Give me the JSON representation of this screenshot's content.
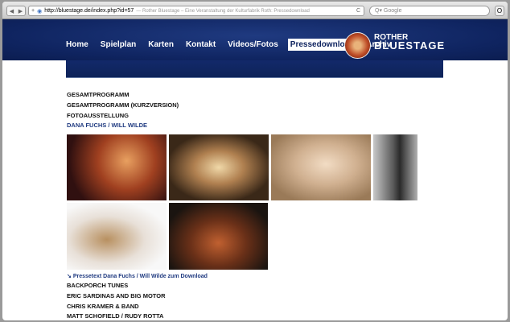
{
  "browser": {
    "url": "http://bluestage.de/index.php?id=57",
    "page_title": "— Rother Bluestage – Eine Veranstaltung der Kulturfabrik Roth: Pressedownload",
    "search_placeholder": "Google",
    "back": "◀",
    "forward": "▶",
    "plus": "+",
    "reload": "C",
    "reader": "O"
  },
  "nav": [
    "Home",
    "Spielplan",
    "Karten",
    "Kontakt",
    "Videos/Fotos",
    "Pressedownload",
    "Archiv"
  ],
  "active_nav": "Pressedownload",
  "logo": {
    "line1": "ROTHER",
    "line2": "BLUESTAGE"
  },
  "list_top": [
    "GESAMTPROGRAMM",
    "GESAMTPROGRAMM (KURZVERSION)",
    "FOTOAUSSTELLUNG",
    "DANA FUCHS / WILL WILDE"
  ],
  "download_link": "Pressetext Dana Fuchs / Will Wilde zum Download",
  "list_bottom": [
    "BACKPORCH TUNES",
    "ERIC SARDINAS AND BIG MOTOR",
    "CHRIS KRAMER & BAND",
    "MATT SCHOFIELD / RUDY ROTTA"
  ],
  "colors": {
    "brand": "#0f2460",
    "link": "#1f3a80"
  }
}
